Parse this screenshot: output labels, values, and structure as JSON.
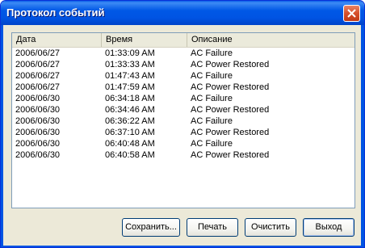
{
  "window": {
    "title": "Протокол событий",
    "close_icon": "close-icon"
  },
  "table": {
    "columns": [
      "Дата",
      "Время",
      "Описание"
    ],
    "rows": [
      [
        "2006/06/27",
        "01:33:09 AM",
        "AC Failure"
      ],
      [
        "2006/06/27",
        "01:33:33 AM",
        "AC Power Restored"
      ],
      [
        "2006/06/27",
        "01:47:43 AM",
        "AC Failure"
      ],
      [
        "2006/06/27",
        "01:47:59 AM",
        "AC Power Restored"
      ],
      [
        "2006/06/30",
        "06:34:18 AM",
        "AC Failure"
      ],
      [
        "2006/06/30",
        "06:34:46 AM",
        "AC Power Restored"
      ],
      [
        "2006/06/30",
        "06:36:22 AM",
        "AC Failure"
      ],
      [
        "2006/06/30",
        "06:37:10 AM",
        "AC Power Restored"
      ],
      [
        "2006/06/30",
        "06:40:48 AM",
        "AC Failure"
      ],
      [
        "2006/06/30",
        "06:40:58 AM",
        "AC Power Restored"
      ]
    ]
  },
  "buttons": {
    "save": "Сохранить...",
    "print": "Печать",
    "clear": "Очистить",
    "exit": "Выход"
  },
  "colors": {
    "titlebar": "#0054e3",
    "close_button": "#d6502c",
    "window_background": "#ece9d8",
    "header_background": "#ebeadb"
  }
}
